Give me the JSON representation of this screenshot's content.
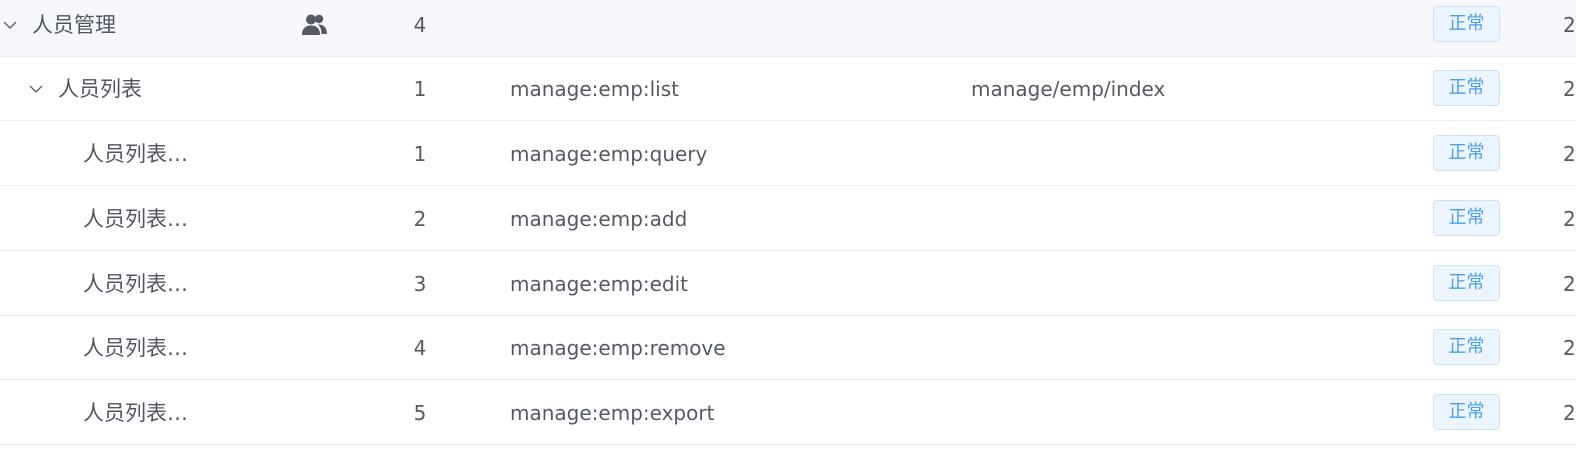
{
  "table": {
    "rows": [
      {
        "name": "人员管理",
        "has_icon": true,
        "icon": "users-icon",
        "order": "4",
        "perms": "",
        "component": "",
        "status": "正常",
        "expandable": true,
        "level": 0,
        "edge": "2"
      },
      {
        "name": "人员列表",
        "has_icon": false,
        "order": "1",
        "perms": "manage:emp:list",
        "component": "manage/emp/index",
        "status": "正常",
        "expandable": true,
        "level": 1,
        "edge": "2"
      },
      {
        "name": "人员列表…",
        "has_icon": false,
        "order": "1",
        "perms": "manage:emp:query",
        "component": "",
        "status": "正常",
        "expandable": false,
        "level": 2,
        "edge": "2"
      },
      {
        "name": "人员列表…",
        "has_icon": false,
        "order": "2",
        "perms": "manage:emp:add",
        "component": "",
        "status": "正常",
        "expandable": false,
        "level": 2,
        "edge": "2"
      },
      {
        "name": "人员列表…",
        "has_icon": false,
        "order": "3",
        "perms": "manage:emp:edit",
        "component": "",
        "status": "正常",
        "expandable": false,
        "level": 2,
        "edge": "2"
      },
      {
        "name": "人员列表…",
        "has_icon": false,
        "order": "4",
        "perms": "manage:emp:remove",
        "component": "",
        "status": "正常",
        "expandable": false,
        "level": 2,
        "edge": "2"
      },
      {
        "name": "人员列表…",
        "has_icon": false,
        "order": "5",
        "perms": "manage:emp:export",
        "component": "",
        "status": "正常",
        "expandable": false,
        "level": 2,
        "edge": "2"
      }
    ]
  },
  "colors": {
    "row_hover": "#f5f7fa",
    "tag_bg": "#ecf5ff",
    "tag_border": "#cfe2f5",
    "tag_text": "#4a9ef0",
    "border": "#e9ecf1"
  }
}
